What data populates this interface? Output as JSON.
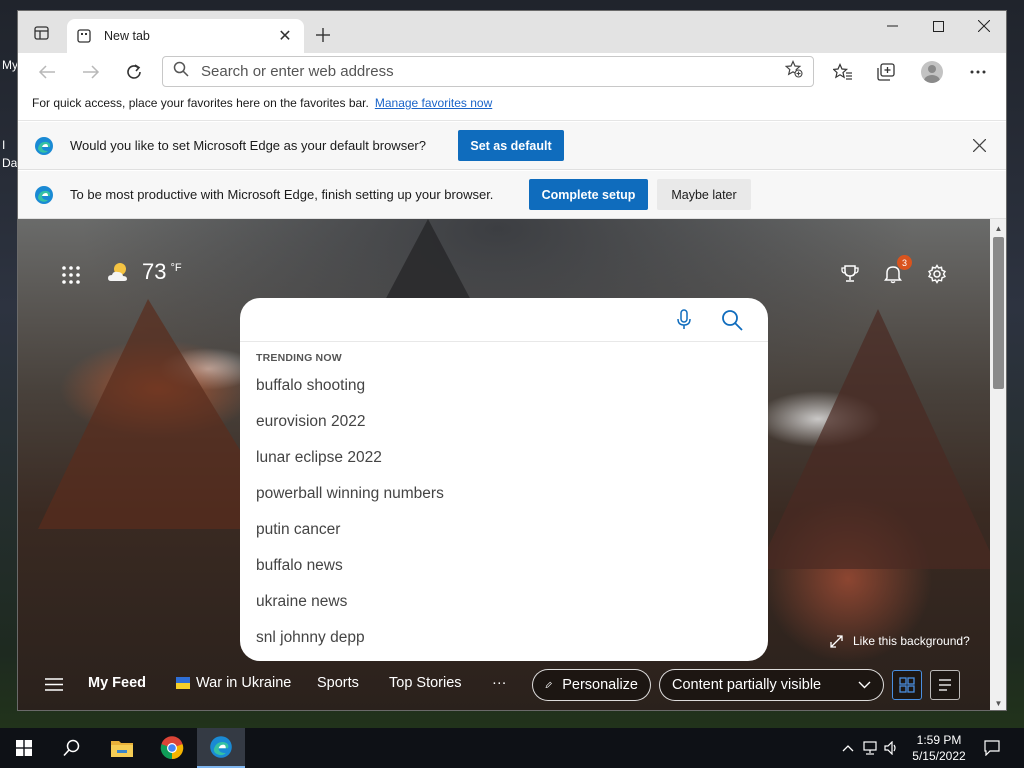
{
  "desktop": {
    "label1": "My",
    "label2": "I",
    "label3": "Da"
  },
  "tab": {
    "title": "New tab"
  },
  "address_bar": {
    "placeholder": "Search or enter web address"
  },
  "favorites_bar": {
    "message": "For quick access, place your favorites here on the favorites bar.",
    "link": "Manage favorites now"
  },
  "default_prompt": {
    "message": "Would you like to set Microsoft Edge as your default browser?",
    "button": "Set as default"
  },
  "setup_prompt": {
    "message": "To be most productive with Microsoft Edge, finish setting up your browser.",
    "primary_button": "Complete setup",
    "secondary_button": "Maybe later"
  },
  "weather": {
    "temperature": "73",
    "unit": "°F"
  },
  "notifications": {
    "count": "3"
  },
  "search": {
    "trending_header": "TRENDING NOW",
    "trending": [
      "buffalo shooting",
      "eurovision 2022",
      "lunar eclipse 2022",
      "powerball winning numbers",
      "putin cancer",
      "buffalo news",
      "ukraine news",
      "snl johnny depp"
    ]
  },
  "background": {
    "like_label": "Like this background?"
  },
  "feed_nav": {
    "items": [
      "My Feed",
      "War in Ukraine",
      "Sports",
      "Top Stories"
    ],
    "more": "···",
    "personalize": "Personalize",
    "content_visibility": "Content partially visible"
  },
  "taskbar": {
    "time": "1:59 PM",
    "date": "5/15/2022"
  },
  "colors": {
    "accent": "#0f6cbd",
    "badge": "#d9541e",
    "link": "#1a64c8"
  }
}
